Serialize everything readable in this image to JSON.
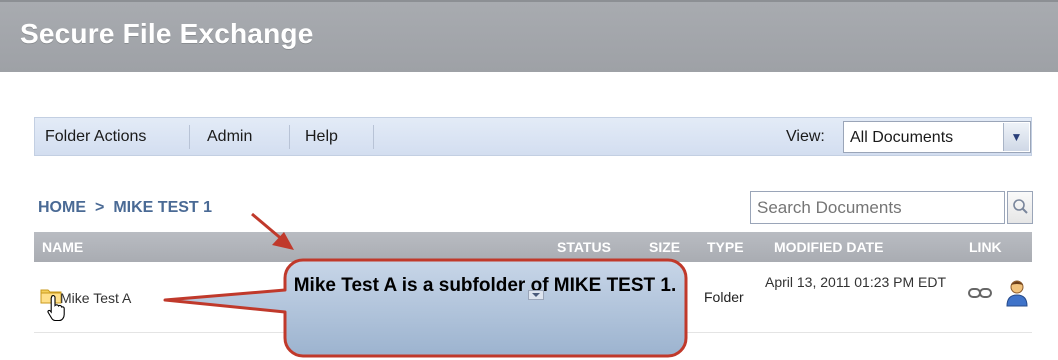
{
  "header": {
    "title": "Secure File Exchange"
  },
  "menu": {
    "items": [
      {
        "label": "Folder Actions"
      },
      {
        "label": "Admin"
      },
      {
        "label": "Help"
      }
    ]
  },
  "view": {
    "label": "View:",
    "selected": "All Documents"
  },
  "breadcrumb": {
    "home": "HOME",
    "separator": ">",
    "current": "MIKE TEST 1"
  },
  "search": {
    "placeholder": "Search Documents"
  },
  "table": {
    "columns": [
      "NAME",
      "STATUS",
      "SIZE",
      "TYPE",
      "MODIFIED DATE",
      "LINK"
    ],
    "rows": [
      {
        "name": "Mike Test A",
        "status": "",
        "size": "",
        "type": "Folder",
        "modified": "April 13, 2011 01:23 PM EDT"
      }
    ]
  },
  "callout": {
    "text": "Mike Test A is a subfolder of MIKE TEST 1."
  },
  "colors": {
    "header_bg": "#a3a6ab",
    "menubar_bg": "#dce5f3",
    "column_header_bg": "#b1b4ba",
    "breadcrumb": "#4a6a95",
    "annotation": "#c0392b",
    "callout_fill": "#a9bed6"
  },
  "icons": [
    "search-icon",
    "chevron-down-icon",
    "folder-icon",
    "hand-cursor-icon",
    "link-icon",
    "user-icon",
    "dropdown-icon"
  ]
}
